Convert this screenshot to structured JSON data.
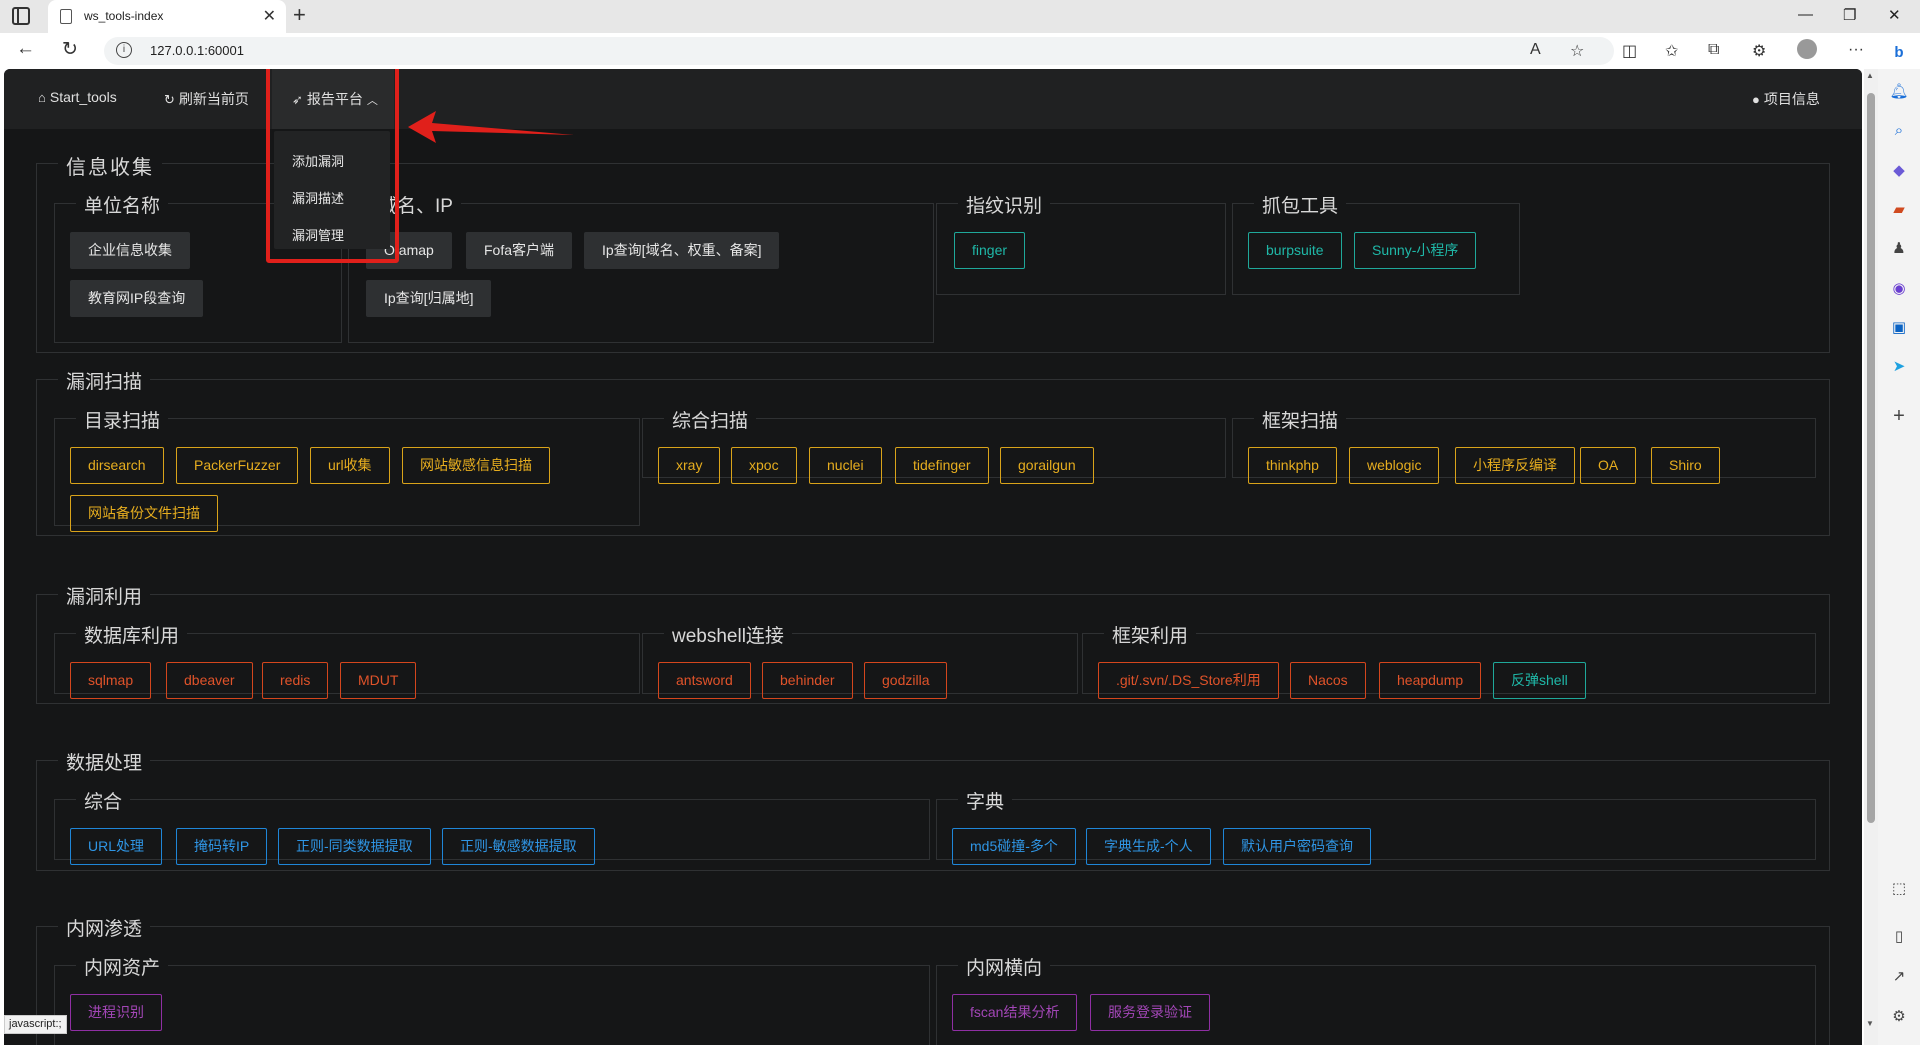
{
  "browser": {
    "tab_title": "ws_tools-index",
    "url": "127.0.0.1:60001",
    "status_text": "javascript:;"
  },
  "nav": {
    "start_tools": "Start_tools",
    "refresh": "刷新当前页",
    "report": "报告平台",
    "project_info": "项目信息",
    "dropdown": [
      "添加漏洞",
      "漏洞描述",
      "漏洞管理"
    ]
  },
  "sections": {
    "info": {
      "title": "信息收集",
      "unit": {
        "title": "单位名称",
        "buttons": [
          "企业信息收集",
          "教育网IP段查询"
        ]
      },
      "domain": {
        "title": "域名、IP",
        "buttons": [
          "Ofamap",
          "Fofa客户端",
          "Ip查询[域名、权重、备案]",
          "Ip查询[归属地]"
        ]
      },
      "finger": {
        "title": "指纹识别",
        "buttons": [
          "finger"
        ]
      },
      "capture": {
        "title": "抓包工具",
        "buttons": [
          "burpsuite",
          "Sunny-小程序"
        ]
      }
    },
    "vuln_scan": {
      "title": "漏洞扫描",
      "dir": {
        "title": "目录扫描",
        "buttons": [
          "dirsearch",
          "PackerFuzzer",
          "url收集",
          "网站敏感信息扫描",
          "网站备份文件扫描"
        ]
      },
      "general": {
        "title": "综合扫描",
        "buttons": [
          "xray",
          "xpoc",
          "nuclei",
          "tidefinger",
          "gorailgun"
        ]
      },
      "framework": {
        "title": "框架扫描",
        "buttons": [
          "thinkphp",
          "weblogic",
          "小程序反编译",
          "OA",
          "Shiro"
        ]
      }
    },
    "vuln_exploit": {
      "title": "漏洞利用",
      "db": {
        "title": "数据库利用",
        "buttons": [
          "sqlmap",
          "dbeaver",
          "redis",
          "MDUT"
        ]
      },
      "webshell": {
        "title": "webshell连接",
        "buttons": [
          "antsword",
          "behinder",
          "godzilla"
        ]
      },
      "framework": {
        "title": "框架利用",
        "buttons": [
          ".git/.svn/.DS_Store利用",
          "Nacos",
          "heapdump",
          "反弹shell"
        ]
      }
    },
    "data": {
      "title": "数据处理",
      "general": {
        "title": "综合",
        "buttons": [
          "URL处理",
          "掩码转IP",
          "正则-同类数据提取",
          "正则-敏感数据提取"
        ]
      },
      "dict": {
        "title": "字典",
        "buttons": [
          "md5碰撞-多个",
          "字典生成-个人",
          "默认用户密码查询"
        ]
      }
    },
    "intranet": {
      "title": "内网渗透",
      "assets": {
        "title": "内网资产",
        "buttons": [
          "进程识别"
        ]
      },
      "lateral": {
        "title": "内网横向",
        "buttons": [
          "fscan结果分析",
          "服务登录验证"
        ]
      }
    }
  },
  "colors": {
    "teal": "#1fb8a8",
    "yellow": "#e6ad1f",
    "red": "#e0532a",
    "blue": "#2f95e4",
    "purple": "#a246b6",
    "highlight": "#e0201b"
  }
}
